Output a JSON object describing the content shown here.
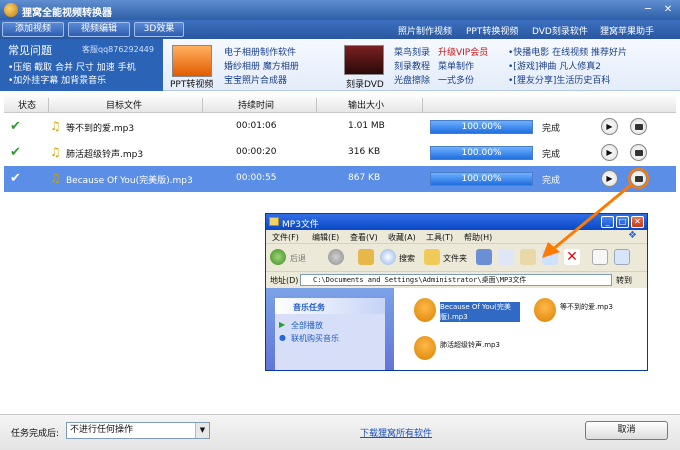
{
  "window": {
    "title": "狸窝全能视频转换器"
  },
  "toolbar": {
    "buttons": [
      "添加视频",
      "视频编辑",
      "3D效果"
    ],
    "links": [
      "照片制作视频",
      "PPT转换视频",
      "DVD刻录软件",
      "狸窝苹果助手"
    ]
  },
  "adbar": {
    "faq_title": "常见问题",
    "faq_qq": "客服qq876292449",
    "faq_line1": "•压缩 截取 合并 尺寸 加速 手机",
    "faq_line2": "•加外挂字幕 加背景音乐",
    "ppt_label": "PPT转视频",
    "col1": [
      "电子相册制作软件",
      "婚纱相册 魔方相册",
      "宝宝照片合成器"
    ],
    "dvd_label": "刻录DVD",
    "col2a": [
      "菜鸟刻录",
      "刻录教程",
      "光盘擦除"
    ],
    "col2b": [
      "升级VIP会员",
      "菜单制作",
      "一式多份"
    ],
    "col3": [
      "•快播电影 在线视频 推荐好片",
      "•[游戏]神曲 凡人修真2",
      "•[狸友分享]生活历史百科"
    ]
  },
  "table": {
    "headers": [
      "状态",
      "目标文件",
      "持续时间",
      "输出大小"
    ],
    "rows": [
      {
        "name": "等不到的爱.mp3",
        "duration": "00:01:06",
        "size": "1.01 MB",
        "progress": "100.00%",
        "status": "完成"
      },
      {
        "name": "肺活超级铃声.mp3",
        "duration": "00:00:20",
        "size": "316 KB",
        "progress": "100.00%",
        "status": "完成"
      },
      {
        "name": "Because Of You(完美版).mp3",
        "duration": "00:00:55",
        "size": "867 KB",
        "progress": "100.00%",
        "status": "完成"
      }
    ]
  },
  "explorer": {
    "title": "MP3文件",
    "menu": [
      "文件(F)",
      "编辑(E)",
      "查看(V)",
      "收藏(A)",
      "工具(T)",
      "帮助(H)"
    ],
    "back": "后退",
    "search": "搜索",
    "folders": "文件夹",
    "address_label": "地址(D)",
    "address": "C:\\Documents and Settings\\Administrator\\桌面\\MP3文件",
    "go": "转到",
    "task_title": "音乐任务",
    "task_items": [
      "全部播放",
      "联机购买音乐"
    ],
    "files": [
      "Because Of You(完美版).mp3",
      "等不到的爱.mp3",
      "肺活超级铃声.mp3"
    ]
  },
  "footer": {
    "after_label": "任务完成后:",
    "after_value": "不进行任何操作",
    "download_link": "下载狸窝所有软件",
    "cancel": "取消"
  },
  "colors": {
    "titlebar": "#2d5fa8",
    "selected_row": "#5b8ee6",
    "arrow": "#ff7a00"
  }
}
